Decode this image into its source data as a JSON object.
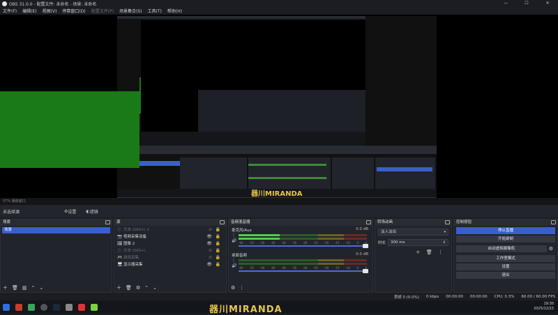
{
  "window": {
    "title": "OBS 31.0.0 - 配置文件: 未命名 - 场景: 未命名",
    "min": "—",
    "max": "☐",
    "close": "✕"
  },
  "menu": [
    {
      "label": "文件(F)",
      "enabled": true
    },
    {
      "label": "编辑(E)",
      "enabled": true
    },
    {
      "label": "视图(V)",
      "enabled": true
    },
    {
      "label": "停靠窗口(D)",
      "enabled": true
    },
    {
      "label": "配置文件(P)",
      "enabled": false
    },
    {
      "label": "场景集合(S)",
      "enabled": true
    },
    {
      "label": "工具(T)",
      "enabled": true
    },
    {
      "label": "帮助(H)",
      "enabled": true
    }
  ],
  "preview": {
    "status": "57%  播放窗口",
    "banner": "器川MIRANDA"
  },
  "source_toolbar": {
    "no_source": "未选择源",
    "properties": "设置",
    "filters": "滤镜"
  },
  "scenes": {
    "title": "场景",
    "items": [
      "场景"
    ]
  },
  "sources": {
    "title": "源",
    "items": [
      {
        "icon": "text",
        "name": "文本 (GDI+) 2",
        "visible": false
      },
      {
        "icon": "camera",
        "name": "视频采集设备",
        "visible": true
      },
      {
        "icon": "image",
        "name": "图像 2",
        "visible": true
      },
      {
        "icon": "text",
        "name": "文本 (GDI+)",
        "visible": false
      },
      {
        "icon": "game",
        "name": "游戏采集",
        "visible": false
      },
      {
        "icon": "monitor",
        "name": "显示器采集",
        "visible": true
      }
    ]
  },
  "mixer": {
    "title": "音频混音器",
    "channels": [
      {
        "name": "麦克风/Aux",
        "db": "0.0 dB",
        "level": 0.32
      },
      {
        "name": "桌面音频",
        "db": "0.0 dB",
        "level": 0.0
      }
    ],
    "ticks": [
      "-60",
      "-55",
      "-50",
      "-45",
      "-40",
      "-35",
      "-30",
      "-25",
      "-20",
      "-15",
      "-10",
      "-5",
      "0"
    ]
  },
  "transitions": {
    "title": "转场动画",
    "selected": "淡入淡出",
    "duration_label": "时长",
    "duration": "300 ms"
  },
  "controls": {
    "title": "控制按钮",
    "buttons": [
      "停止直播",
      "开始录制",
      "启动虚拟摄像机",
      "工作室模式",
      "设置",
      "退出"
    ]
  },
  "status": {
    "dropped": "丢帧 0 (0.0%)",
    "bitrate": "0 kbps",
    "live": "00:00:00",
    "rec": "00:00:00",
    "cpu": "CPU: 0.3%",
    "fps": "60.00 / 60.00 FPS"
  },
  "taskbar": {
    "time": "19:30",
    "date": "2025/12/23"
  }
}
